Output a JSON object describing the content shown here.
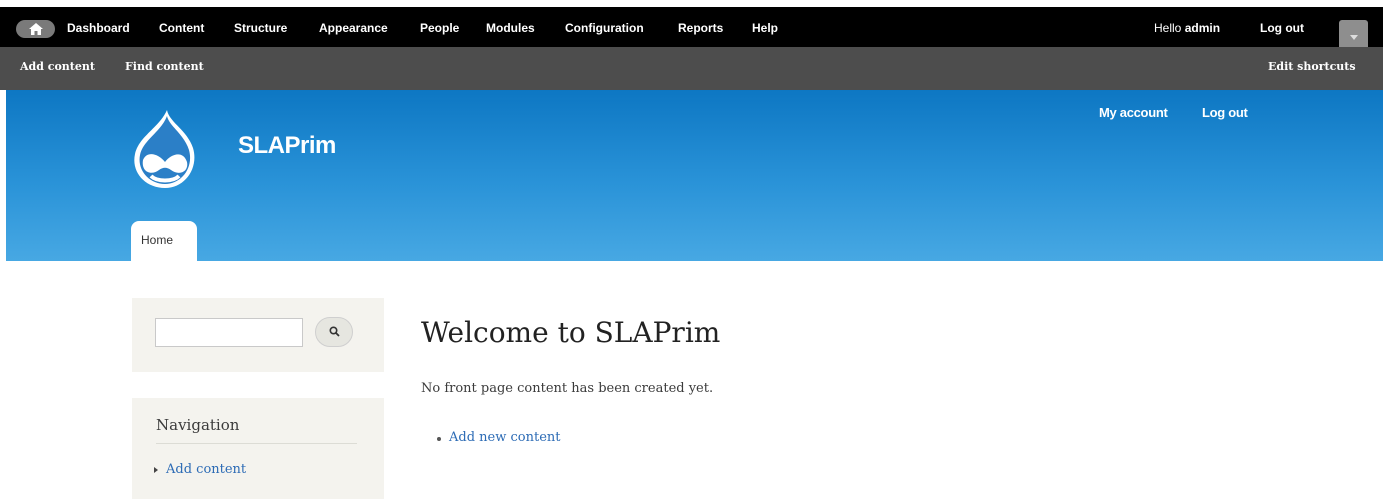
{
  "toolbar": {
    "menu": [
      "Dashboard",
      "Content",
      "Structure",
      "Appearance",
      "People",
      "Modules",
      "Configuration",
      "Reports",
      "Help"
    ],
    "greeting": "Hello ",
    "username": "admin",
    "logout": "Log out",
    "home_icon": "home-icon",
    "drawer_icon": "chevron-down-icon"
  },
  "shortcuts": {
    "items": [
      "Add content",
      "Find content"
    ],
    "edit": "Edit shortcuts"
  },
  "header": {
    "site_name": "SLAPrim",
    "secondary": [
      "My account",
      "Log out"
    ],
    "tabs": [
      "Home"
    ],
    "logo_icon": "drupal-logo"
  },
  "search": {
    "placeholder": "",
    "icon": "search-icon"
  },
  "navigation": {
    "title": "Navigation",
    "items": [
      "Add content"
    ]
  },
  "main": {
    "title": "Welcome to SLAPrim",
    "message": "No front page content has been created yet.",
    "links": [
      "Add new content"
    ]
  },
  "colors": {
    "toolbar": "#000000",
    "shortcuts": "#4d4d4d",
    "header_top": "#0d77c3",
    "header_bottom": "#47a8e3",
    "link": "#2c6bb5",
    "sidebar_bg": "#f4f3ee"
  }
}
